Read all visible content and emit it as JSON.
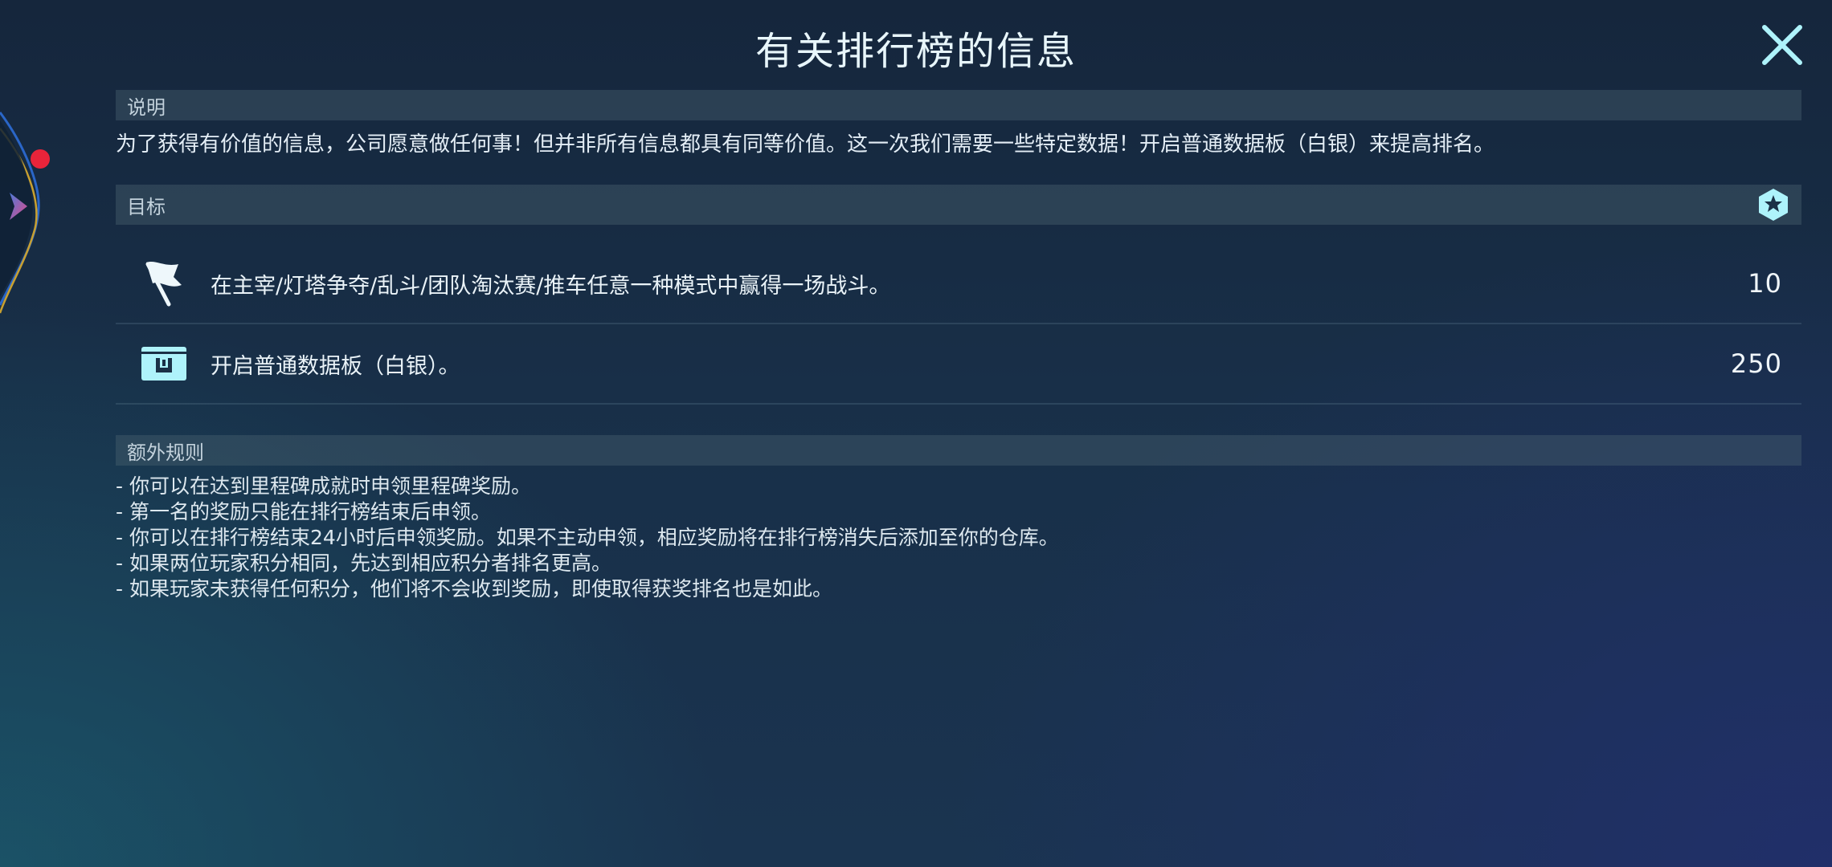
{
  "header": {
    "title": "有关排行榜的信息"
  },
  "description": {
    "header": "说明",
    "text": "为了获得有价值的信息，公司愿意做任何事！但并非所有信息都具有同等价值。这一次我们需要一些特定数据！开启普通数据板（白银）来提高排名。"
  },
  "goals": {
    "header": "目标",
    "items": [
      {
        "icon": "flag-icon",
        "text": "在主宰/灯塔争夺/乱斗/团队淘汰赛/推车任意一种模式中赢得一场战斗。",
        "points": "10"
      },
      {
        "icon": "data-pad-icon",
        "text": "开启普通数据板（白银）。",
        "points": "250"
      }
    ]
  },
  "rules": {
    "header": "额外规则",
    "items": [
      "- 你可以在达到里程碑成就时申领里程碑奖励。",
      "- 第一名的奖励只能在排行榜结束后申领。",
      "- 你可以在排行榜结束24小时后申领奖励。如果不主动申领，相应奖励将在排行榜消失后添加至你的仓库。",
      "- 如果两位玩家积分相同，先达到相应积分者排名更高。",
      "- 如果玩家未获得任何积分，他们将不会收到奖励，即使取得获奖排名也是如此。"
    ]
  },
  "colors": {
    "accent": "#aef3fb",
    "notification_dot": "#e8243a",
    "section_header_bg": "#4a6270"
  }
}
